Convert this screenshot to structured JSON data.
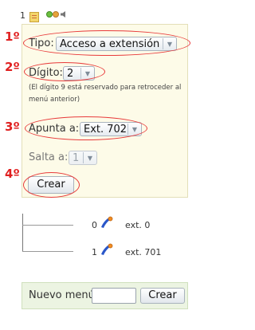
{
  "top": {
    "number": "1"
  },
  "form": {
    "tipo_label": "Tipo:",
    "tipo_value": "Acceso a extensión",
    "digito_label": "Dígito:",
    "digito_value": "2",
    "note": "(El dígito 9 está reservado para retroceder al menú anterior)",
    "apunta_label": "Apunta a:",
    "apunta_value": "Ext. 702",
    "salta_label": "Salta a:",
    "salta_value": "1",
    "create_button": "Crear"
  },
  "annotations": {
    "step1": "1º",
    "step2": "2º",
    "step3": "3º",
    "step4": "4º",
    "color": "#e02020"
  },
  "tree": [
    {
      "digit": "0",
      "ext": "ext. 0",
      "icon": "phone-icon"
    },
    {
      "digit": "1",
      "ext": "ext. 701",
      "icon": "phone-icon"
    }
  ],
  "new_menu": {
    "label": "Nuevo menú:",
    "input_value": "",
    "button": "Crear"
  },
  "colors": {
    "panel_bg": "#fdfbe8",
    "bottom_bg": "#ecf4e2",
    "accent_red": "#e83a3a"
  }
}
